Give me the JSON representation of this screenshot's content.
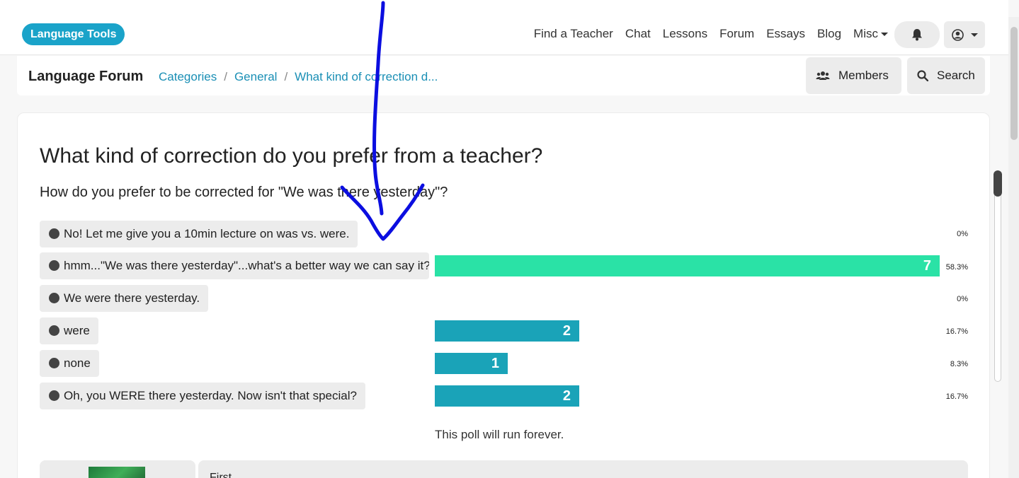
{
  "nav": {
    "brand": "Language Tools",
    "links": [
      "Find a Teacher",
      "Chat",
      "Lessons",
      "Forum",
      "Essays",
      "Blog",
      "Misc"
    ]
  },
  "breadcrumb": {
    "forum_title": "Language Forum",
    "items": [
      "Categories",
      "General",
      "What kind of correction d..."
    ],
    "members_label": "Members",
    "search_label": "Search"
  },
  "post": {
    "title": "What kind of correction do you prefer from a teacher?",
    "question": "How do you prefer to be corrected for \"We was there yesterday\"?"
  },
  "poll": {
    "options": [
      {
        "text": "No! Let me give you a 10min lecture on was vs. were.",
        "votes": null,
        "percent": "0%"
      },
      {
        "text": "hmm...\"We was there yesterday\"...what's a better way we can say it?",
        "votes": "7",
        "percent": "58.3%"
      },
      {
        "text": "We were there yesterday.",
        "votes": null,
        "percent": "0%"
      },
      {
        "text": "were",
        "votes": "2",
        "percent": "16.7%"
      },
      {
        "text": "none",
        "votes": "1",
        "percent": "8.3%"
      },
      {
        "text": "Oh, you WERE there yesterday. Now isn't that special?",
        "votes": "2",
        "percent": "16.7%"
      }
    ],
    "note": "This poll will run forever.",
    "colors": {
      "leader": "#2ae2a6",
      "normal": "#1aa3b8"
    }
  },
  "post_preview": {
    "text": "First, ..."
  }
}
